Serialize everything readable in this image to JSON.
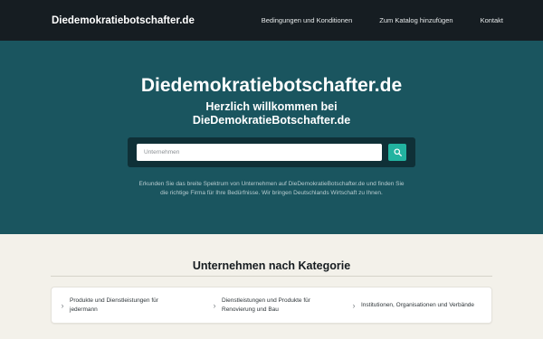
{
  "header": {
    "brand": "Diedemokratiebotschafter.de",
    "nav": [
      {
        "label": "Bedingungen und Konditionen"
      },
      {
        "label": "Zum Katalog hinzufügen"
      },
      {
        "label": "Kontakt"
      }
    ]
  },
  "hero": {
    "title": "Diedemokratiebotschafter.de",
    "subtitle_line1": "Herzlich willkommen bei",
    "subtitle_line2": "DieDemokratieBotschafter.de",
    "search": {
      "placeholder": "Unternehmen",
      "icon": "search-icon"
    },
    "description_line1": "Erkunden Sie das breite Spektrum von Unternehmen auf DieDemokratieBotschafter.de und finden Sie",
    "description_line2": "die richtige Firma für Ihre Bedürfnisse. Wir bringen Deutschlands Wirtschaft zu Ihnen."
  },
  "categories": {
    "title": "Unternehmen nach Kategorie",
    "items": [
      {
        "line1": "Produkte und Dienstleistungen für",
        "line2": "jedermann",
        "icon": "chevron-right-icon"
      },
      {
        "line1": "Dienstleistungen und Produkte für",
        "line2": "Renovierung und Bau",
        "icon": "chevron-right-icon"
      },
      {
        "line1": "Institutionen, Organisationen und Verbände",
        "line2": "",
        "icon": "chevron-right-icon"
      }
    ]
  },
  "colors": {
    "navbar": "#161d22",
    "hero": "#1a555f",
    "search_panel": "#0f3037",
    "accent": "#22b3a0",
    "page_bg": "#f3f1ea"
  }
}
